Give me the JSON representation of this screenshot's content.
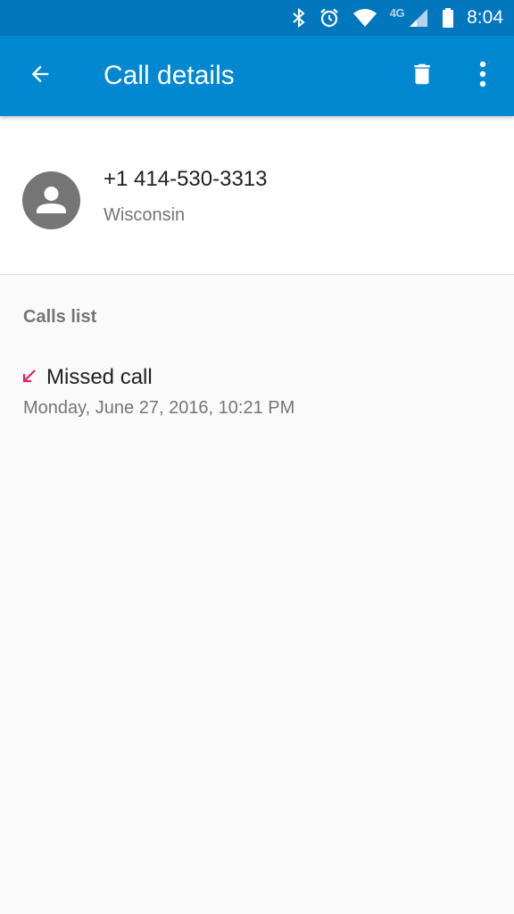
{
  "status_bar": {
    "network_label": "4G",
    "time": "8:04",
    "icons": [
      "bluetooth-icon",
      "alarm-icon",
      "wifi-icon",
      "cell-signal-icon",
      "battery-icon"
    ]
  },
  "toolbar": {
    "title": "Call details",
    "back_icon": "arrow-back-icon",
    "delete_icon": "trash-icon",
    "more_icon": "more-vert-icon"
  },
  "contact": {
    "number": "+1 414-530-3313",
    "location": "Wisconsin",
    "avatar_icon": "person-icon"
  },
  "calls": {
    "header": "Calls list",
    "items": [
      {
        "type": "Missed call",
        "datetime": "Monday, June 27, 2016, 10:21 PM",
        "icon": "missed-call-icon"
      }
    ]
  },
  "colors": {
    "status_bar": "#0277bd",
    "toolbar": "#0288d1",
    "missed_call": "#e91e63",
    "avatar": "#757575",
    "background": "#fafafa"
  }
}
